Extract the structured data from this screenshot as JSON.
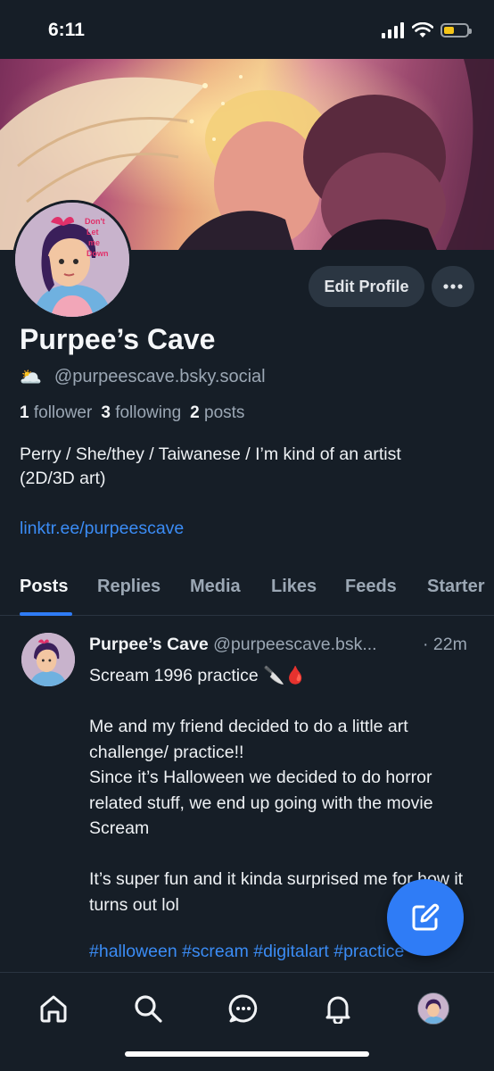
{
  "status_bar": {
    "time": "6:11"
  },
  "profile": {
    "display_name": "Purpee’s Cave",
    "handle_emoji": "🌥️",
    "handle": "@purpeescave.bsky.social",
    "followers_count": "1",
    "followers_label": "follower",
    "following_count": "3",
    "following_label": "following",
    "posts_count": "2",
    "posts_label": "posts",
    "bio": "Perry / She/they / Taiwanese / I’m kind of an artist\n(2D/3D art)",
    "link": "linktr.ee/purpeescave",
    "edit_label": "Edit Profile"
  },
  "tabs": [
    "Posts",
    "Replies",
    "Media",
    "Likes",
    "Feeds",
    "Starter"
  ],
  "post": {
    "author": "Purpee’s Cave",
    "handle": "@purpeescave.bsk...",
    "time": "· 22m",
    "body": "Scream 1996 practice 🔪🩸\n\nMe and my friend decided to do a little art challenge/ practice!!\nSince it’s Halloween we decided to do horror related stuff, we end up going with the movie Scream\n\nIt’s super fun and it kinda surprised me for how it turns out lol",
    "tags": "#halloween #scream #digitalart #practice"
  },
  "colors": {
    "background": "#161e27",
    "accent": "#2f7cf6",
    "link": "#3b8cf5",
    "muted_text": "#9ba7b4",
    "battery": "#f5c518"
  },
  "icons": {
    "status": [
      "signal-icon",
      "wifi-icon",
      "battery-icon"
    ],
    "nav": [
      "home-icon",
      "search-icon",
      "chat-icon",
      "bell-icon",
      "profile-avatar"
    ],
    "fab": "compose-icon",
    "more": "ellipsis-icon"
  },
  "avatar_text": "Don't Let me Down",
  "battery_level": 0.45
}
